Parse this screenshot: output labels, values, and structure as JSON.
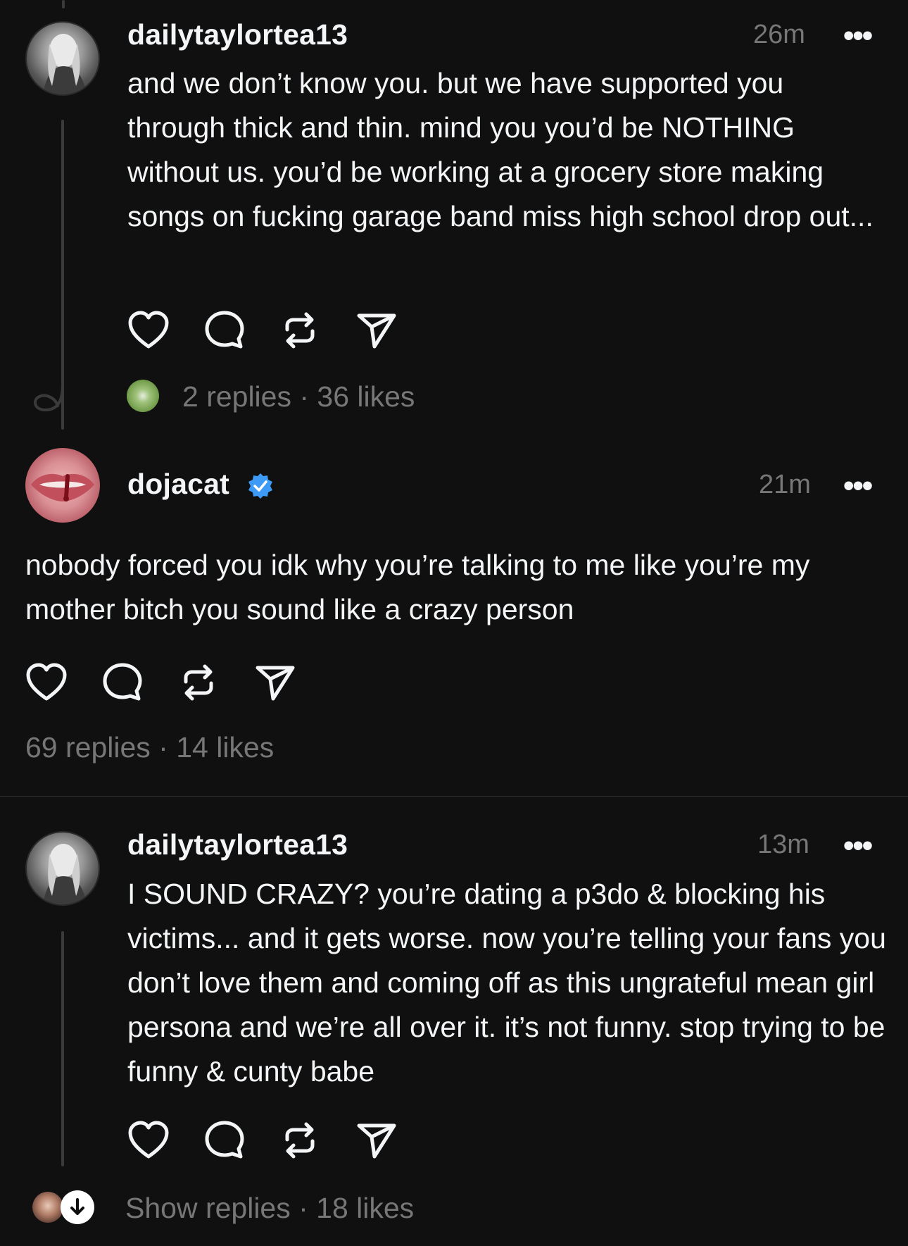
{
  "posts": [
    {
      "username": "dailytaylortea13",
      "time": "26m",
      "more": "•••",
      "text": "and we don’t know you. but we have supported you through thick and thin. mind you you’d be NOTHING without us. you’d be working at a grocery store making songs on fucking garage band miss high school drop out...",
      "meta": "2 replies · 36 likes"
    },
    {
      "username": "dojacat",
      "verified": true,
      "time": "21m",
      "more": "•••",
      "text": "nobody forced you idk why you’re talking to me like you’re my mother bitch you sound like a crazy person",
      "meta": "69 replies · 14 likes"
    },
    {
      "username": "dailytaylortea13",
      "time": "13m",
      "more": "•••",
      "text": "I SOUND CRAZY? you’re dating a p3do & blocking his victims... and it gets worse. now you’re telling your fans you don’t love them and coming off as this ungrateful mean girl persona and we’re all over it. it’s not funny. stop trying to be funny & cunty babe",
      "meta": "Show replies · 18 likes"
    }
  ],
  "icons": {
    "like": "heart-icon",
    "reply": "comment-icon",
    "repost": "repost-icon",
    "share": "send-icon",
    "verified": "verified-badge-icon",
    "expand": "arrow-down-icon"
  },
  "colors": {
    "background": "#101010",
    "text": "#f3f5f7",
    "muted": "#777777",
    "verified": "#3d9bf7",
    "thread_line": "#3a3a3a"
  }
}
